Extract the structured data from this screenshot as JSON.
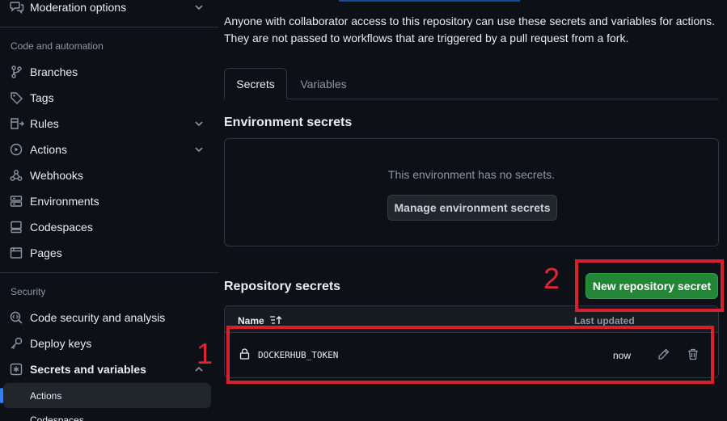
{
  "sidebar": {
    "moderation_label": "Moderation options",
    "section_code_automation": "Code and automation",
    "items_code": [
      {
        "label": "Branches",
        "icon": "branch-icon"
      },
      {
        "label": "Tags",
        "icon": "tag-icon"
      },
      {
        "label": "Rules",
        "icon": "rules-icon"
      },
      {
        "label": "Actions",
        "icon": "play-icon"
      },
      {
        "label": "Webhooks",
        "icon": "webhook-icon"
      },
      {
        "label": "Environments",
        "icon": "server-icon"
      },
      {
        "label": "Codespaces",
        "icon": "codespaces-icon"
      },
      {
        "label": "Pages",
        "icon": "browser-icon"
      }
    ],
    "section_security": "Security",
    "items_security": [
      {
        "label": "Code security and analysis",
        "icon": "codescan-icon"
      },
      {
        "label": "Deploy keys",
        "icon": "key-icon"
      },
      {
        "label": "Secrets and variables",
        "icon": "asterisk-icon"
      }
    ],
    "sub_items": [
      {
        "label": "Actions",
        "active": true
      },
      {
        "label": "Codespaces",
        "active": false
      }
    ]
  },
  "main": {
    "intro_line1": "Anyone with collaborator access to this repository can use these secrets and variables for actions.",
    "intro_line2": "They are not passed to workflows that are triggered by a pull request from a fork.",
    "tabs": [
      {
        "label": "Secrets",
        "active": true
      },
      {
        "label": "Variables",
        "active": false
      }
    ],
    "env_heading": "Environment secrets",
    "env_empty": "This environment has no secrets.",
    "env_button": "Manage environment secrets",
    "repo_heading": "Repository secrets",
    "new_button": "New repository secret",
    "table": {
      "col_name": "Name",
      "col_updated": "Last updated",
      "rows": [
        {
          "name": "DOCKERHUB_TOKEN",
          "updated": "now"
        }
      ]
    }
  },
  "annotations": {
    "label_1": "1",
    "label_2": "2",
    "color": "#d6202c"
  },
  "colors": {
    "background": "#0d1117",
    "primary_button": "#238636",
    "accent": "#2f81f7"
  }
}
